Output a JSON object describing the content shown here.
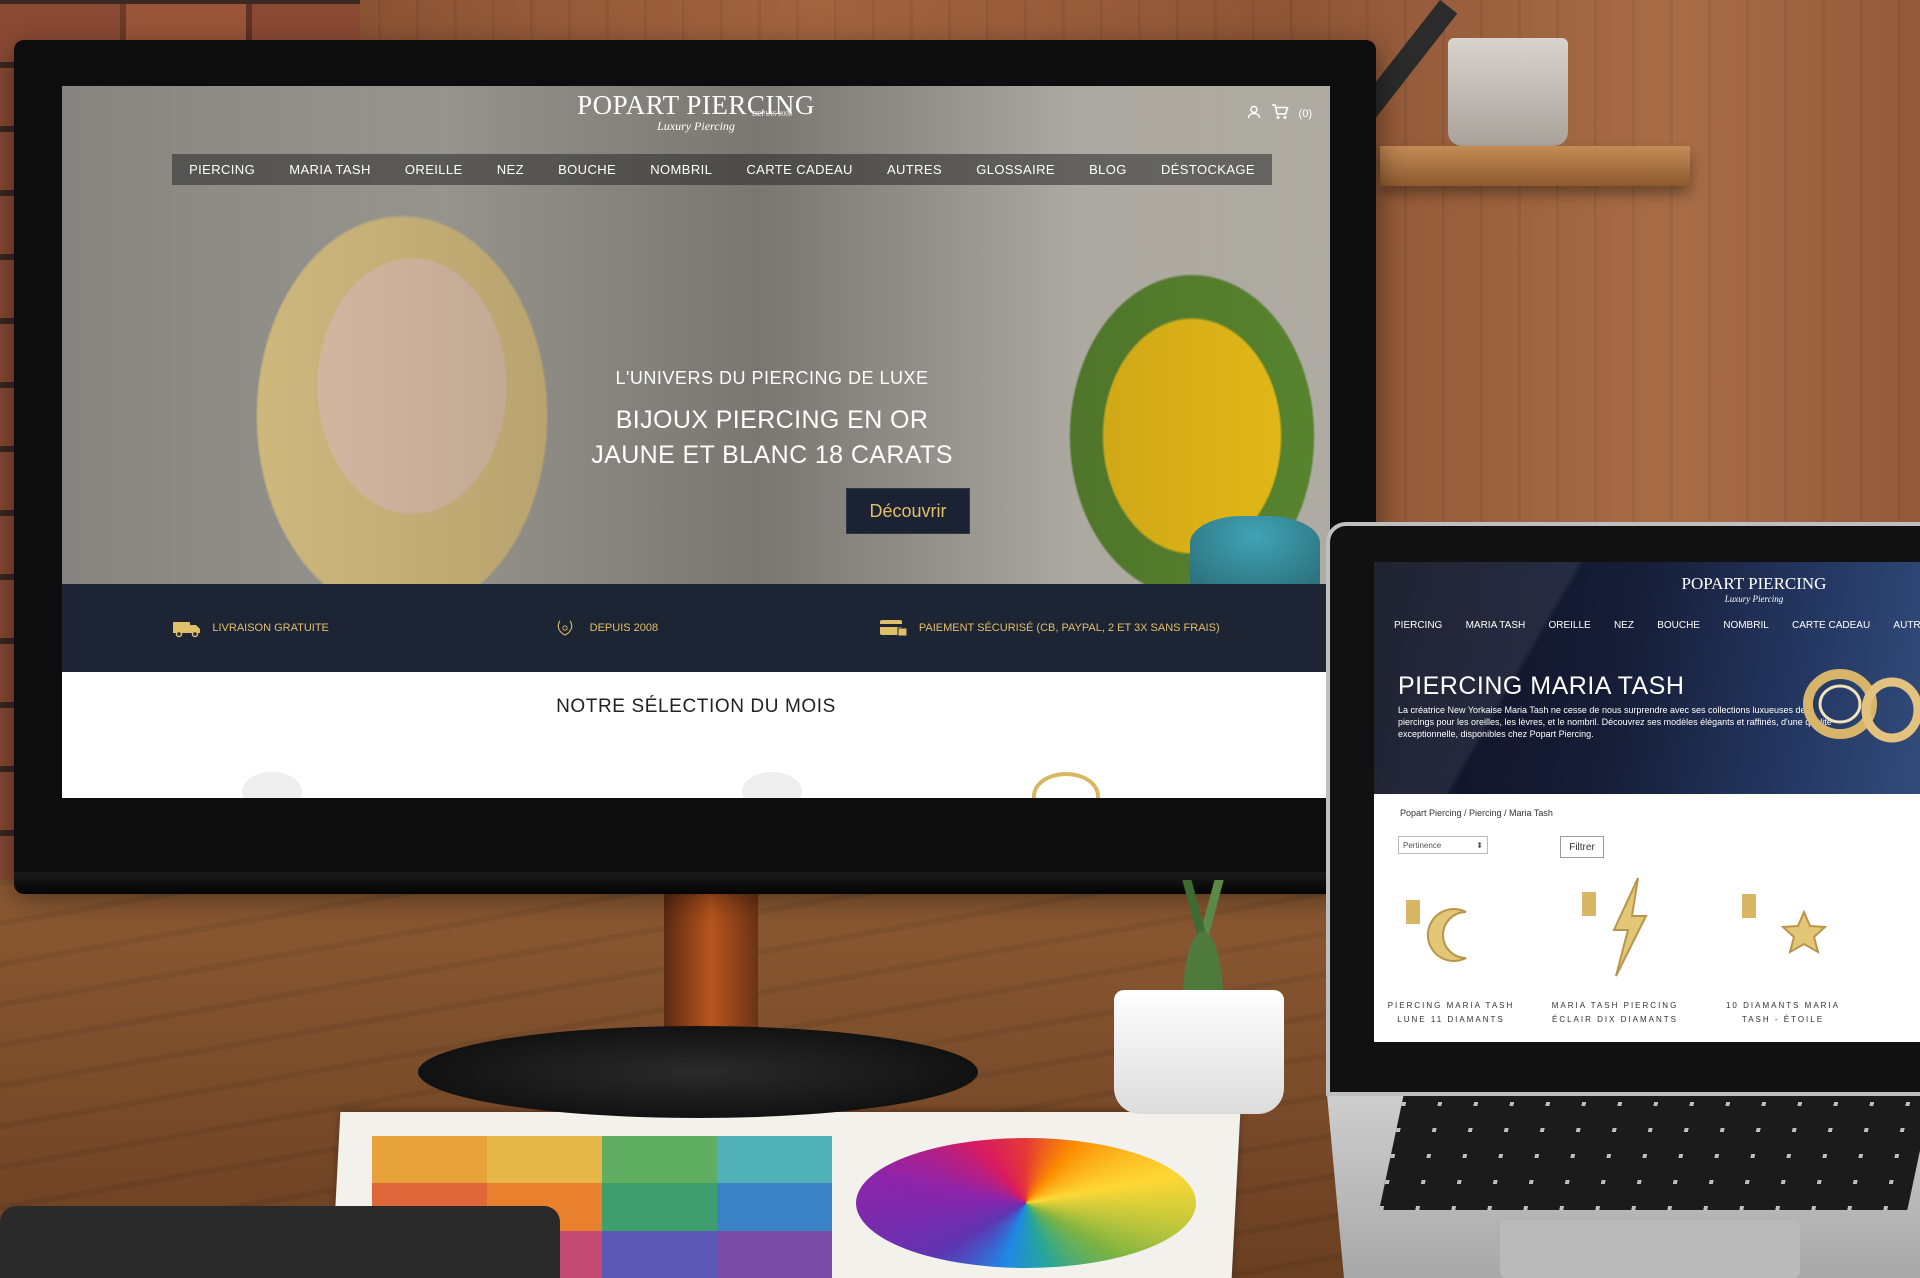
{
  "monitor_site": {
    "logo": {
      "main": "POPART PIERCING",
      "sub": "Luxury Piercing",
      "since": "DEPUIS 2008"
    },
    "header": {
      "account_icon": "user-icon",
      "cart_icon": "cart-icon",
      "cart_count": "(0)"
    },
    "nav": [
      "PIERCING",
      "MARIA TASH",
      "OREILLE",
      "NEZ",
      "BOUCHE",
      "NOMBRIL",
      "CARTE CADEAU",
      "AUTRES",
      "GLOSSAIRE",
      "BLOG",
      "DÉSTOCKAGE"
    ],
    "hero": {
      "kicker": "L'UNIVERS DU PIERCING DE LUXE",
      "title_line1": "BIJOUX PIERCING EN OR",
      "title_line2": "JAUNE ET BLANC 18 CARATS",
      "cta": "Découvrir"
    },
    "benefits": [
      {
        "icon": "truck-icon",
        "label": "LIVRAISON GRATUITE"
      },
      {
        "icon": "laurel-icon",
        "label": "DEPUIS 2008"
      },
      {
        "icon": "credit-card-lock-icon",
        "label": "PAIEMENT SÉCURISÉ (CB, PAYPAL, 2 ET 3X SANS FRAIS)"
      }
    ],
    "section_title": "NOTRE SÉLECTION DU MOIS"
  },
  "laptop_site": {
    "logo": {
      "main": "POPART PIERCING",
      "sub": "Luxury Piercing"
    },
    "nav": [
      "PIERCING",
      "MARIA TASH",
      "OREILLE",
      "NEZ",
      "BOUCHE",
      "NOMBRIL",
      "CARTE CADEAU",
      "AUTRES"
    ],
    "page_title": "PIERCING MARIA TASH",
    "description": "La créatrice New Yorkaise Maria Tash ne cesse de nous surprendre avec ses collections luxueuses de piercings pour les oreilles, les lèvres, et le nombril. Découvrez ses modèles élégants et raffinés, d'une qualité exceptionnelle, disponibles chez Popart Piercing.",
    "breadcrumb": "Popart Piercing  /  Piercing  /  Maria Tash",
    "sort_select": "Pertinence",
    "filter_button": "Filtrer",
    "products": [
      {
        "line1": "PIERCING MARIA TASH",
        "line2": "LUNE 11 DIAMANTS"
      },
      {
        "line1": "MARIA TASH PIERCING",
        "line2": "ÉCLAIR DIX DIAMANTS"
      },
      {
        "line1": "10 DIAMANTS MARIA",
        "line2": "TASH - ÉTOILE"
      }
    ]
  },
  "colors": {
    "navy": "#1d2434",
    "gold": "#e0bf6a"
  }
}
